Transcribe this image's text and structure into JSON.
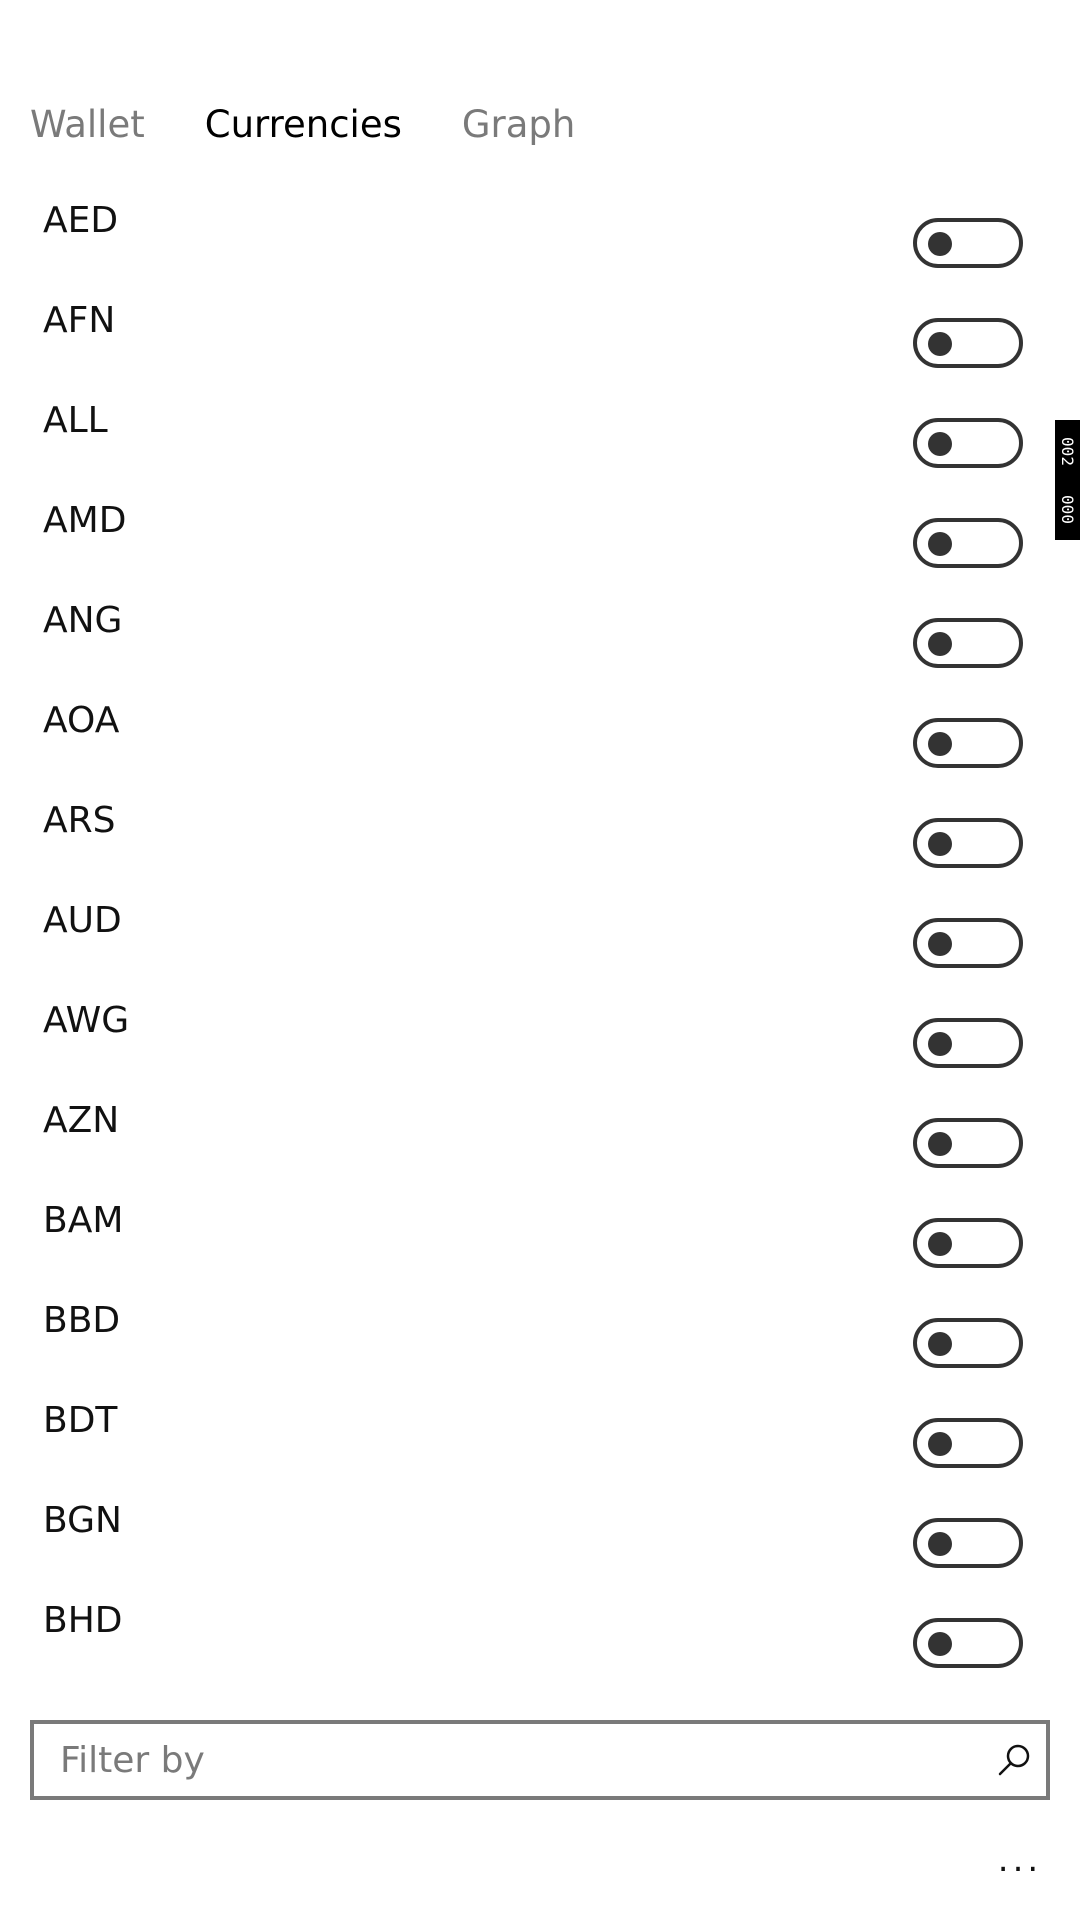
{
  "pivot": {
    "tabs": [
      {
        "label": "Wallet",
        "active": false
      },
      {
        "label": "Currencies",
        "active": true
      },
      {
        "label": "Graph",
        "active": false
      }
    ]
  },
  "currencies": [
    {
      "code": "AED",
      "enabled": false
    },
    {
      "code": "AFN",
      "enabled": false
    },
    {
      "code": "ALL",
      "enabled": false
    },
    {
      "code": "AMD",
      "enabled": false
    },
    {
      "code": "ANG",
      "enabled": false
    },
    {
      "code": "AOA",
      "enabled": false
    },
    {
      "code": "ARS",
      "enabled": false
    },
    {
      "code": "AUD",
      "enabled": false
    },
    {
      "code": "AWG",
      "enabled": false
    },
    {
      "code": "AZN",
      "enabled": false
    },
    {
      "code": "BAM",
      "enabled": false
    },
    {
      "code": "BBD",
      "enabled": false
    },
    {
      "code": "BDT",
      "enabled": false
    },
    {
      "code": "BGN",
      "enabled": false
    },
    {
      "code": "BHD",
      "enabled": false
    }
  ],
  "scroll_indicator": {
    "text_top": "002",
    "text_bottom": "000"
  },
  "filter": {
    "value": "",
    "placeholder": "Filter by",
    "icon": "search-icon"
  },
  "more": {
    "label": "...",
    "icon": "more-options-icon"
  },
  "colors": {
    "background": "#ffffff",
    "text": "#111111",
    "muted": "#7a7a7a",
    "toggle": "#333333"
  }
}
